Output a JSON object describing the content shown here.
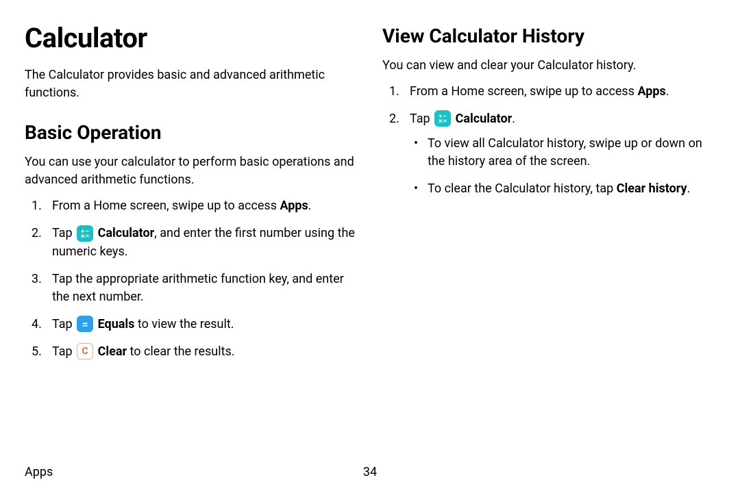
{
  "title": "Calculator",
  "intro": "The Calculator provides basic and advanced arithmetic functions.",
  "basic": {
    "heading": "Basic Operation",
    "intro": "You can use your calculator to perform basic operations and advanced arithmetic functions.",
    "steps": {
      "s1_pre": "From a Home screen, swipe up to access ",
      "s1_bold": "Apps",
      "s1_post": ".",
      "s2_pre": "Tap ",
      "s2_bold": "Calculator",
      "s2_post": ", and enter the first number using the numeric keys.",
      "s3": "Tap the appropriate arithmetic function key, and enter the next number.",
      "s4_pre": "Tap ",
      "s4_bold": "Equals",
      "s4_post": " to view the result.",
      "s5_pre": "Tap ",
      "s5_bold": "Clear",
      "s5_post": " to clear the results."
    }
  },
  "history": {
    "heading": "View Calculator History",
    "intro": "You can view and clear your Calculator history.",
    "steps": {
      "s1_pre": "From a Home screen, swipe up to access ",
      "s1_bold": "Apps",
      "s1_post": ".",
      "s2_pre": "Tap ",
      "s2_bold": "Calculator",
      "s2_post": "."
    },
    "bullets": {
      "b1": "To view all Calculator history, swipe up or down on the history area of the screen.",
      "b2_pre": "To clear the Calculator history, tap ",
      "b2_bold": "Clear history",
      "b2_post": "."
    }
  },
  "footer": {
    "section": "Apps",
    "page": "34"
  }
}
